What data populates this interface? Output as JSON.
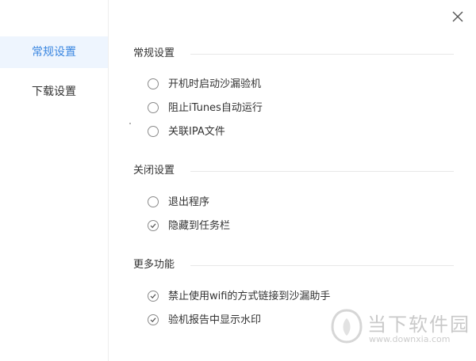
{
  "sidebar": {
    "items": [
      {
        "label": "常规设置",
        "active": true
      },
      {
        "label": "下载设置",
        "active": false
      }
    ]
  },
  "close": {
    "icon": "close-icon"
  },
  "sections": [
    {
      "title": "常规设置",
      "options": [
        {
          "label": "开机时启动沙漏验机",
          "checked": false
        },
        {
          "label": "阻止iTunes自动运行",
          "checked": false
        },
        {
          "label": "关联IPA文件",
          "checked": false
        }
      ]
    },
    {
      "title": "关闭设置",
      "options": [
        {
          "label": "退出程序",
          "checked": false
        },
        {
          "label": "隐藏到任务栏",
          "checked": true
        }
      ]
    },
    {
      "title": "更多功能",
      "options": [
        {
          "label": "禁止使用wifi的方式链接到沙漏助手",
          "checked": true
        },
        {
          "label": "验机报告中显示水印",
          "checked": true
        }
      ]
    }
  ],
  "watermark": {
    "title": "当下软件园",
    "url": "www.downxia.com"
  },
  "colors": {
    "accent": "#3a86e0",
    "active_bg": "#eef5fe",
    "text": "#333333"
  }
}
